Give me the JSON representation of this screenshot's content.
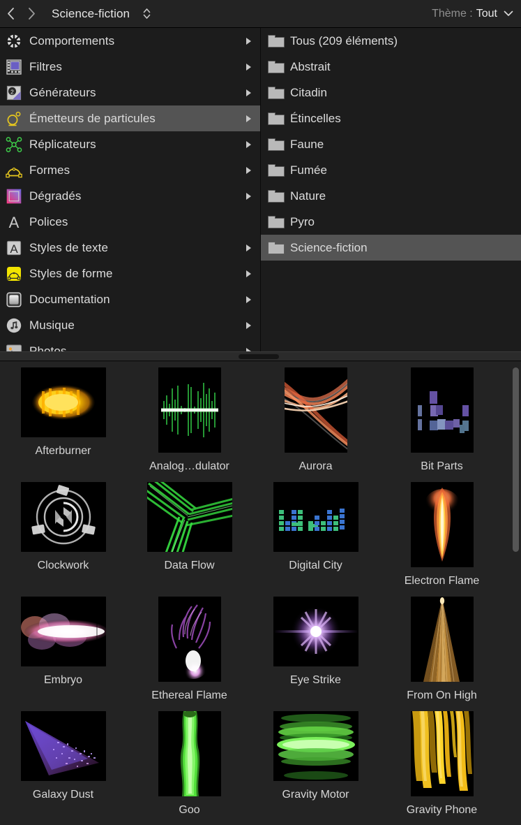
{
  "header": {
    "back_icon": "chevron-left-icon",
    "forward_icon": "chevron-right-icon",
    "title": "Science-fiction",
    "stepper_up": "⌃",
    "stepper_down": "⌄",
    "theme_label": "Thème :",
    "theme_value": "Tout",
    "theme_chevron": "⌄"
  },
  "categories": [
    {
      "label": "Comportements",
      "icon": "gear-icon",
      "has_arrow": true,
      "selected": false
    },
    {
      "label": "Filtres",
      "icon": "filmstrip-icon",
      "has_arrow": true,
      "selected": false
    },
    {
      "label": "Générateurs",
      "icon": "generator-icon",
      "has_arrow": true,
      "selected": false
    },
    {
      "label": "Émetteurs de particules",
      "icon": "particle-emitter-icon",
      "has_arrow": true,
      "selected": true
    },
    {
      "label": "Réplicateurs",
      "icon": "replicator-icon",
      "has_arrow": true,
      "selected": false
    },
    {
      "label": "Formes",
      "icon": "shape-icon",
      "has_arrow": true,
      "selected": false
    },
    {
      "label": "Dégradés",
      "icon": "gradient-icon",
      "has_arrow": true,
      "selected": false
    },
    {
      "label": "Polices",
      "icon": "font-icon",
      "has_arrow": false,
      "selected": false
    },
    {
      "label": "Styles de texte",
      "icon": "text-style-icon",
      "has_arrow": true,
      "selected": false
    },
    {
      "label": "Styles de forme",
      "icon": "shape-style-icon",
      "has_arrow": true,
      "selected": false
    },
    {
      "label": "Documentation",
      "icon": "documentation-icon",
      "has_arrow": true,
      "selected": false
    },
    {
      "label": "Musique",
      "icon": "music-note-icon",
      "has_arrow": true,
      "selected": false
    },
    {
      "label": "Photos",
      "icon": "photos-icon",
      "has_arrow": true,
      "selected": false
    }
  ],
  "folders": [
    {
      "label": "Tous (209 éléments)",
      "selected": false
    },
    {
      "label": "Abstrait",
      "selected": false
    },
    {
      "label": "Citadin",
      "selected": false
    },
    {
      "label": "Étincelles",
      "selected": false
    },
    {
      "label": "Faune",
      "selected": false
    },
    {
      "label": "Fumée",
      "selected": false
    },
    {
      "label": "Nature",
      "selected": false
    },
    {
      "label": "Pyro",
      "selected": false
    },
    {
      "label": "Science-fiction",
      "selected": true
    }
  ],
  "items": [
    {
      "label": "Afterburner",
      "art": "afterburner",
      "orient": "wide"
    },
    {
      "label": "Analog…dulator",
      "art": "waveform",
      "orient": "tall"
    },
    {
      "label": "Aurora",
      "art": "aurora",
      "orient": "tall"
    },
    {
      "label": "Bit Parts",
      "art": "bitparts",
      "orient": "tall"
    },
    {
      "label": "Clockwork",
      "art": "clockwork",
      "orient": "wide"
    },
    {
      "label": "Data Flow",
      "art": "dataflow",
      "orient": "wide"
    },
    {
      "label": "Digital City",
      "art": "digitalcity",
      "orient": "wide"
    },
    {
      "label": "Electron Flame",
      "art": "electronflame",
      "orient": "tall"
    },
    {
      "label": "Embryo",
      "art": "embryo",
      "orient": "wide"
    },
    {
      "label": "Ethereal Flame",
      "art": "etherealflame",
      "orient": "tall"
    },
    {
      "label": "Eye Strike",
      "art": "eyestrike",
      "orient": "wide"
    },
    {
      "label": "From On High",
      "art": "fromonhigh",
      "orient": "tall"
    },
    {
      "label": "Galaxy Dust",
      "art": "galaxydust",
      "orient": "wide"
    },
    {
      "label": "Goo",
      "art": "goo",
      "orient": "tall"
    },
    {
      "label": "Gravity Motor",
      "art": "gravitymotor",
      "orient": "wide"
    },
    {
      "label": "Gravity Phone",
      "art": "gravityphone",
      "orient": "tall"
    }
  ],
  "colors": {
    "window_bg": "#1e1e1e",
    "header_bg": "#232323",
    "browser_bg": "#1c1c1c",
    "grid_bg": "#232323",
    "selection": "#545454",
    "text": "#dcdcdc",
    "accent_yellow": "#e8c81e",
    "accent_green": "#3ecf4a",
    "accent_purple": "#b06fd8"
  }
}
